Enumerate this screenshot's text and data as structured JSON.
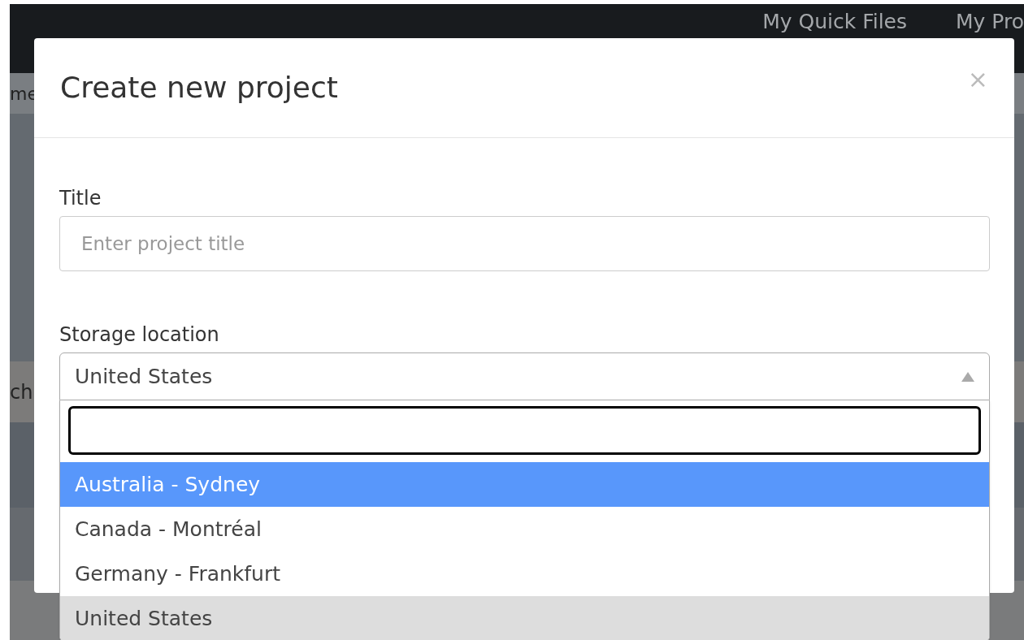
{
  "navbar": {
    "links": [
      "My Quick Files",
      "My Pro"
    ]
  },
  "background_fragments": [
    "me",
    "ch"
  ],
  "modal": {
    "title": "Create new project",
    "close": "×",
    "fields": [
      {
        "kind": "text",
        "label": "Title",
        "placeholder": "Enter project title"
      },
      {
        "kind": "select",
        "label": "Storage location",
        "value": "United States",
        "expanded": true,
        "options": [
          {
            "label": "Australia - Sydney",
            "highlighted": true,
            "selected": false
          },
          {
            "label": "Canada - Montréal",
            "highlighted": false,
            "selected": false
          },
          {
            "label": "Germany - Frankfurt",
            "highlighted": false,
            "selected": false
          },
          {
            "label": "United States",
            "highlighted": false,
            "selected": true
          }
        ]
      }
    ]
  }
}
